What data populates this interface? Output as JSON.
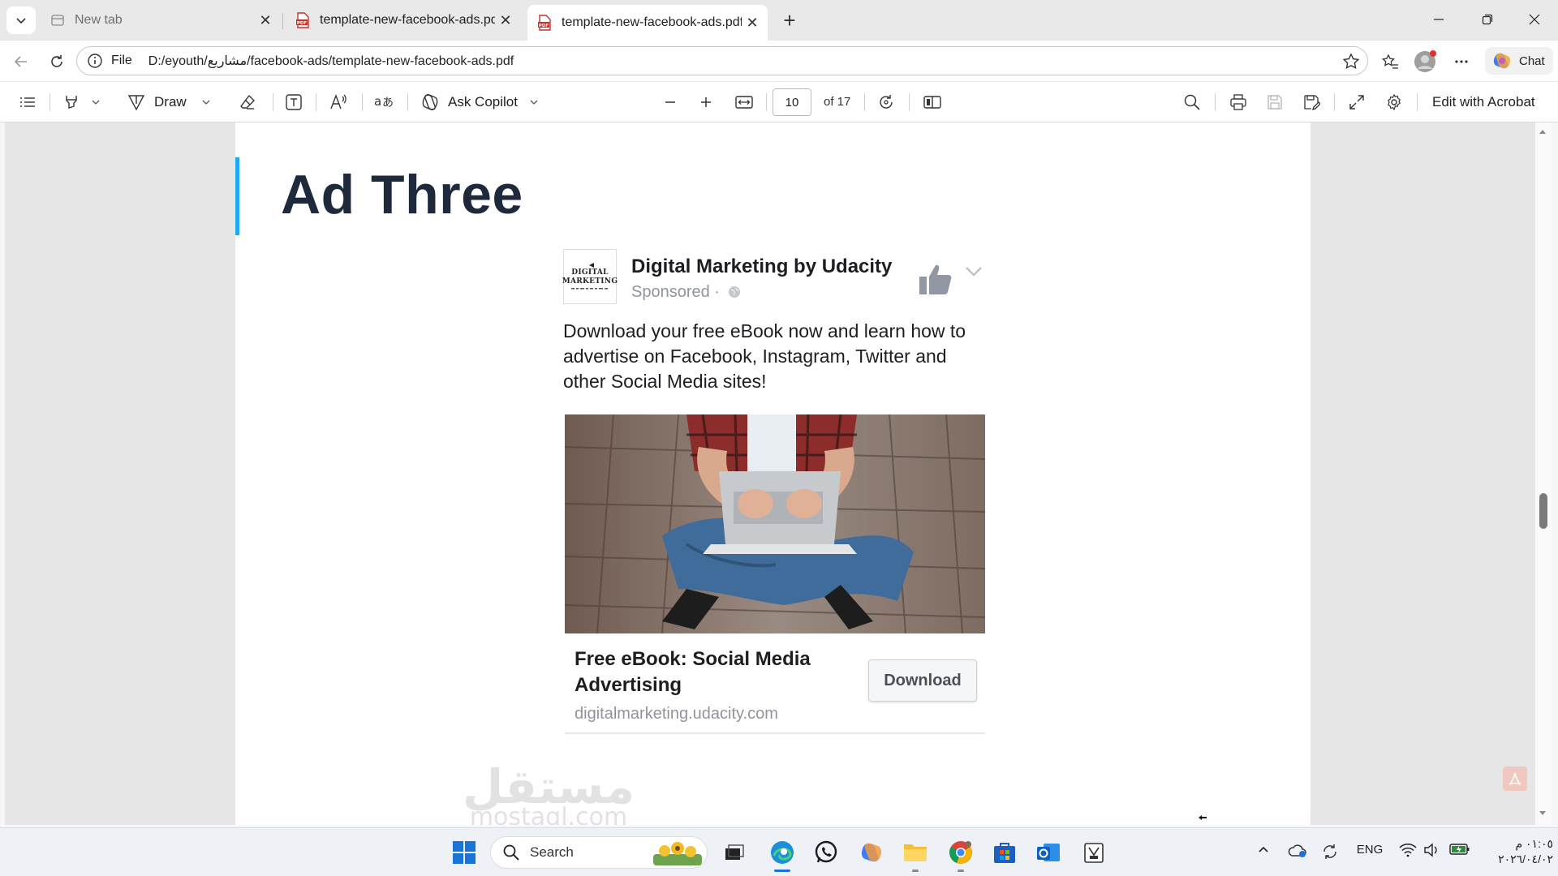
{
  "browser": {
    "tabs": [
      {
        "title": "New tab",
        "active": false
      },
      {
        "title": "template-new-facebook-ads.pdf",
        "active": false
      },
      {
        "title": "template-new-facebook-ads.pdf",
        "active": true
      }
    ],
    "address": {
      "scheme": "File",
      "url": "D:/eyouth/مشاريع/facebook-ads/template-new-facebook-ads.pdf"
    },
    "chat_label": "Chat"
  },
  "pdf_toolbar": {
    "draw_label": "Draw",
    "copilot_label": "Ask Copilot",
    "page_current": "10",
    "page_total_label": "of 17",
    "edit_label": "Edit with Acrobat"
  },
  "document": {
    "title": "Ad Three",
    "ad": {
      "logo_lines": [
        "DIGITAL",
        "MARKETING"
      ],
      "page_name": "Digital Marketing by Udacity",
      "sponsored": "Sponsored ·",
      "body": "Download your free eBook now and learn how to advertise on Facebook, Instagram, Twitter and other Social Media sites!",
      "headline": "Free eBook: Social Media Advertising",
      "domain": "digitalmarketing.udacity.com",
      "cta": "Download"
    },
    "watermark": {
      "arabic": "مستقل",
      "latin": "mostaql.com"
    }
  },
  "taskbar": {
    "search_placeholder": "Search",
    "language": "ENG",
    "time": "٠١:٠٥ م",
    "date": "٢٠٢٦/٠٤/٠٢"
  },
  "colors": {
    "accent_bar": "#1eaaf1",
    "title_text": "#1e2a3b",
    "facebook_grey": "#90949c"
  }
}
